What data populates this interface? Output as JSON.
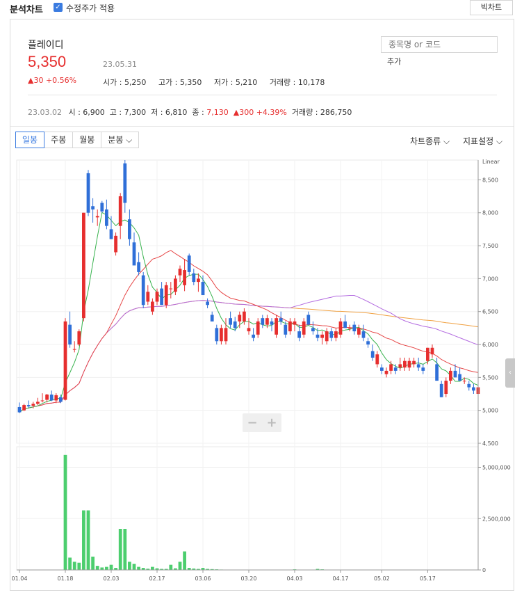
{
  "header": {
    "title": "분석차트",
    "adjusted_label": "수정주가 적용",
    "big_chart_label": "빅차트"
  },
  "stock": {
    "name": "플레이디",
    "price": "5,350",
    "date": "23.05.31",
    "change": "▲30 +0.56%",
    "open": "시가 : 5,250",
    "high": "고가 : 5,350",
    "low": "저가 : 5,210",
    "volume": "거래량 : 10,178"
  },
  "search": {
    "placeholder": "종목명 or 코드",
    "add_label": "추가"
  },
  "hover": {
    "date": "23.03.02",
    "open": "시 : 6,900",
    "high": "고 : 7,300",
    "low": "저 : 6,810",
    "close_label": "종 : ",
    "close": "7,130",
    "change": "▲300 +4.39%",
    "volume": "거래량 : 286,750"
  },
  "tabs": [
    {
      "label": "일봉",
      "active": true
    },
    {
      "label": "주봉",
      "active": false
    },
    {
      "label": "월봉",
      "active": false
    },
    {
      "label": "분봉 ⌵",
      "active": false
    }
  ],
  "menus": {
    "chart_type": "차트종류 ⌵",
    "indicators": "지표설정 ⌵"
  },
  "icons": [
    "check-icon",
    "zoom-out-icon",
    "zoom-in-icon",
    "chevron-left-icon"
  ],
  "zoom": {
    "minus": "−",
    "plus": "+"
  },
  "colors": {
    "up": "#e62e2e",
    "down": "#2f6fd8",
    "ma5": "#37b24d",
    "ma20": "#e64646",
    "ma60": "#b36be0",
    "ma120": "#f0a040",
    "volume": "#4cce6e"
  },
  "chart_data": {
    "type": "candlestick",
    "scale_label": "Linear",
    "price_axis": {
      "ylim": [
        4500,
        8800
      ],
      "ticks": [
        "8,500",
        "8,000",
        "7,500",
        "7,000",
        "6,500",
        "6,000",
        "5,500",
        "5,000",
        "4,500"
      ]
    },
    "volume_axis": {
      "ylim": [
        0,
        6000000
      ],
      "ticks": [
        "5,000,000",
        "2,500,000",
        "0"
      ]
    },
    "date_ticks": [
      {
        "label": "01.04",
        "i": 0
      },
      {
        "label": "01.18",
        "i": 10
      },
      {
        "label": "02.03",
        "i": 20
      },
      {
        "label": "02.17",
        "i": 30
      },
      {
        "label": "03.06",
        "i": 40
      },
      {
        "label": "03.20",
        "i": 50
      },
      {
        "label": "04.03",
        "i": 60
      },
      {
        "label": "04.17",
        "i": 70
      },
      {
        "label": "05.02",
        "i": 79
      },
      {
        "label": "05.17",
        "i": 89
      }
    ],
    "ohlc": [
      [
        5050,
        5120,
        4960,
        4970
      ],
      [
        5000,
        5100,
        4990,
        5080
      ],
      [
        5080,
        5150,
        5040,
        5060
      ],
      [
        5070,
        5130,
        5030,
        5100
      ],
      [
        5100,
        5190,
        5080,
        5130
      ],
      [
        5140,
        5260,
        5120,
        5150
      ],
      [
        5160,
        5250,
        5120,
        5240
      ],
      [
        5240,
        5300,
        5140,
        5150
      ],
      [
        5150,
        5260,
        5110,
        5230
      ],
      [
        5200,
        5240,
        5110,
        5130
      ],
      [
        5160,
        6400,
        5150,
        6350
      ],
      [
        6300,
        6500,
        5950,
        6000
      ],
      [
        5920,
        6050,
        5880,
        5930
      ],
      [
        6000,
        6230,
        5980,
        6200
      ],
      [
        6400,
        8000,
        6350,
        8000
      ],
      [
        8600,
        8650,
        7950,
        8000
      ],
      [
        8100,
        8220,
        7850,
        8050
      ],
      [
        7930,
        8050,
        7800,
        7950
      ],
      [
        8150,
        8180,
        8000,
        8020
      ],
      [
        8050,
        8200,
        7750,
        7800
      ],
      [
        7750,
        7950,
        7600,
        7600
      ],
      [
        7400,
        7700,
        7350,
        7650
      ],
      [
        7800,
        8300,
        7600,
        8250
      ],
      [
        8750,
        8800,
        8000,
        8150
      ],
      [
        7900,
        8050,
        7500,
        7600
      ],
      [
        7550,
        7700,
        7350,
        7200
      ],
      [
        7250,
        7400,
        7050,
        7100
      ],
      [
        7050,
        7100,
        6550,
        6600
      ],
      [
        6650,
        6900,
        6600,
        6800
      ],
      [
        6500,
        6700,
        6450,
        6650
      ],
      [
        6650,
        6850,
        6600,
        6800
      ],
      [
        6850,
        6950,
        6600,
        6600
      ],
      [
        6600,
        6950,
        6550,
        6900
      ],
      [
        6850,
        6950,
        6700,
        6850
      ],
      [
        6800,
        7050,
        6750,
        7000
      ],
      [
        7050,
        7200,
        6950,
        7150
      ],
      [
        6900,
        7300,
        6810,
        7130
      ],
      [
        7350,
        7380,
        7050,
        7100
      ],
      [
        7080,
        7150,
        6900,
        6950
      ],
      [
        6950,
        7080,
        6800,
        7000
      ],
      [
        6950,
        7050,
        6750,
        6750
      ],
      [
        6650,
        6700,
        6550,
        6600
      ],
      [
        6450,
        6500,
        6350,
        6350
      ],
      [
        6250,
        6300,
        6000,
        6050
      ],
      [
        6050,
        6300,
        6000,
        6250
      ],
      [
        6050,
        6400,
        6000,
        6250
      ],
      [
        6400,
        6500,
        6250,
        6300
      ],
      [
        6350,
        6420,
        6200,
        6250
      ],
      [
        6350,
        6500,
        6250,
        6450
      ],
      [
        6350,
        6550,
        6300,
        6500
      ],
      [
        6200,
        6400,
        6150,
        6250
      ],
      [
        6150,
        6250,
        6050,
        6100
      ],
      [
        6150,
        6400,
        6100,
        6350
      ],
      [
        6400,
        6450,
        6250,
        6300
      ],
      [
        6300,
        6450,
        6250,
        6400
      ],
      [
        6350,
        6400,
        6200,
        6300
      ],
      [
        6150,
        6450,
        6100,
        6400
      ],
      [
        6400,
        6500,
        6300,
        6350
      ],
      [
        6300,
        6350,
        6100,
        6150
      ],
      [
        6200,
        6400,
        6150,
        6350
      ],
      [
        6300,
        6400,
        6200,
        6350
      ],
      [
        6200,
        6300,
        6050,
        6100
      ],
      [
        6150,
        6400,
        6100,
        6350
      ],
      [
        6450,
        6500,
        6300,
        6300
      ],
      [
        6250,
        6350,
        6150,
        6200
      ],
      [
        6150,
        6250,
        6050,
        6100
      ],
      [
        6100,
        6200,
        6000,
        6150
      ],
      [
        6050,
        6250,
        6000,
        6200
      ],
      [
        6200,
        6250,
        6050,
        6100
      ],
      [
        6100,
        6250,
        6050,
        6200
      ],
      [
        6150,
        6400,
        6100,
        6350
      ],
      [
        6350,
        6450,
        6250,
        6250
      ],
      [
        6250,
        6300,
        6200,
        6250
      ],
      [
        6300,
        6350,
        6150,
        6200
      ],
      [
        6150,
        6300,
        6100,
        6250
      ],
      [
        6200,
        6300,
        6050,
        6100
      ],
      [
        6050,
        6100,
        5950,
        6000
      ],
      [
        5900,
        6000,
        5750,
        5800
      ],
      [
        5700,
        5900,
        5650,
        5850
      ],
      [
        5650,
        5700,
        5550,
        5600
      ],
      [
        5550,
        5650,
        5500,
        5600
      ],
      [
        5600,
        5750,
        5550,
        5700
      ],
      [
        5650,
        5700,
        5550,
        5600
      ],
      [
        5650,
        5800,
        5600,
        5700
      ],
      [
        5650,
        5800,
        5600,
        5750
      ],
      [
        5650,
        5800,
        5600,
        5750
      ],
      [
        5700,
        5800,
        5650,
        5750
      ],
      [
        5700,
        5800,
        5600,
        5650
      ],
      [
        5650,
        5700,
        5550,
        5600
      ],
      [
        5750,
        5950,
        5700,
        5950
      ],
      [
        5850,
        6000,
        5800,
        5950
      ],
      [
        5700,
        5800,
        5450,
        5450
      ],
      [
        5400,
        5450,
        5200,
        5200
      ],
      [
        5250,
        5500,
        5200,
        5450
      ],
      [
        5450,
        5650,
        5400,
        5600
      ],
      [
        5600,
        5700,
        5500,
        5500
      ],
      [
        5550,
        5650,
        5450,
        5450
      ],
      [
        5450,
        5500,
        5400,
        5450
      ],
      [
        5400,
        5450,
        5300,
        5350
      ],
      [
        5350,
        5400,
        5250,
        5300
      ],
      [
        5250,
        5350,
        5210,
        5350
      ]
    ],
    "volume": [
      [
        0,
        0
      ],
      [
        1,
        0
      ],
      [
        2,
        0
      ],
      [
        3,
        0
      ],
      [
        4,
        0
      ],
      [
        5,
        0
      ],
      [
        6,
        0
      ],
      [
        7,
        0
      ],
      [
        8,
        0
      ],
      [
        9,
        0
      ],
      [
        10,
        5600000
      ],
      [
        11,
        600000
      ],
      [
        12,
        400000
      ],
      [
        13,
        350000
      ],
      [
        14,
        2900000
      ],
      [
        15,
        2900000
      ],
      [
        16,
        650000
      ],
      [
        17,
        200000
      ],
      [
        18,
        120000
      ],
      [
        19,
        150000
      ],
      [
        20,
        250000
      ],
      [
        21,
        100000
      ],
      [
        22,
        2000000
      ],
      [
        23,
        2000000
      ],
      [
        24,
        400000
      ],
      [
        25,
        300000
      ],
      [
        26,
        150000
      ],
      [
        27,
        100000
      ],
      [
        28,
        60000
      ],
      [
        29,
        150000
      ],
      [
        30,
        80000
      ],
      [
        31,
        50000
      ],
      [
        32,
        50000
      ],
      [
        33,
        250000
      ],
      [
        34,
        80000
      ],
      [
        35,
        400000
      ],
      [
        36,
        900000
      ],
      [
        37,
        100000
      ],
      [
        38,
        70000
      ],
      [
        39,
        50000
      ],
      [
        40,
        100000
      ],
      [
        41,
        50000
      ],
      [
        42,
        40000
      ],
      [
        43,
        30000
      ],
      [
        44,
        20000
      ],
      [
        60,
        30000
      ],
      [
        65,
        50000
      ],
      [
        66,
        30000
      ]
    ]
  }
}
